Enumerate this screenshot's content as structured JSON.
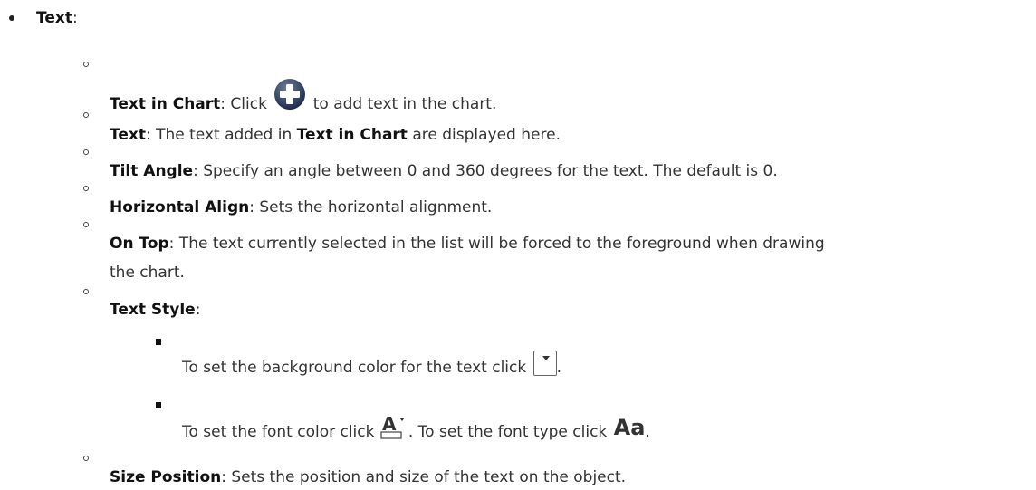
{
  "top": {
    "term": "Text",
    "suffix": ":"
  },
  "items": {
    "text_in_chart": {
      "term": "Text in Chart",
      "before": ": Click ",
      "after": " to add text in the chart."
    },
    "text": {
      "term": "Text",
      "before": ": The text added in ",
      "link": "Text in Chart",
      "after": " are displayed here."
    },
    "tilt_angle": {
      "term": "Tilt Angle",
      "desc": ": Specify an angle between 0 and 360 degrees for the text. The default is 0."
    },
    "horizontal_align": {
      "term": "Horizontal Align",
      "desc": ": Sets the horizontal alignment."
    },
    "on_top": {
      "term": "On Top",
      "desc_line1": ": The text currently selected in the list will be forced to the foreground when drawing",
      "desc_line2": "the chart."
    },
    "text_style": {
      "term": "Text Style",
      "suffix": ":"
    },
    "size_position": {
      "term": "Size Position",
      "desc": ": Sets the position and size of the text on the object."
    }
  },
  "style_items": {
    "background": {
      "before": "To set the background color for the text click ",
      "after": "."
    },
    "font": {
      "before": "To set the font color click ",
      "middle": ". To set the font type click ",
      "font_glyph": "Aa",
      "after": "."
    }
  },
  "icons": {
    "add": "plus-circle-icon",
    "background_color": "dropdown-icon",
    "font_color": "font-color-icon",
    "font_type": "font-type-icon"
  }
}
